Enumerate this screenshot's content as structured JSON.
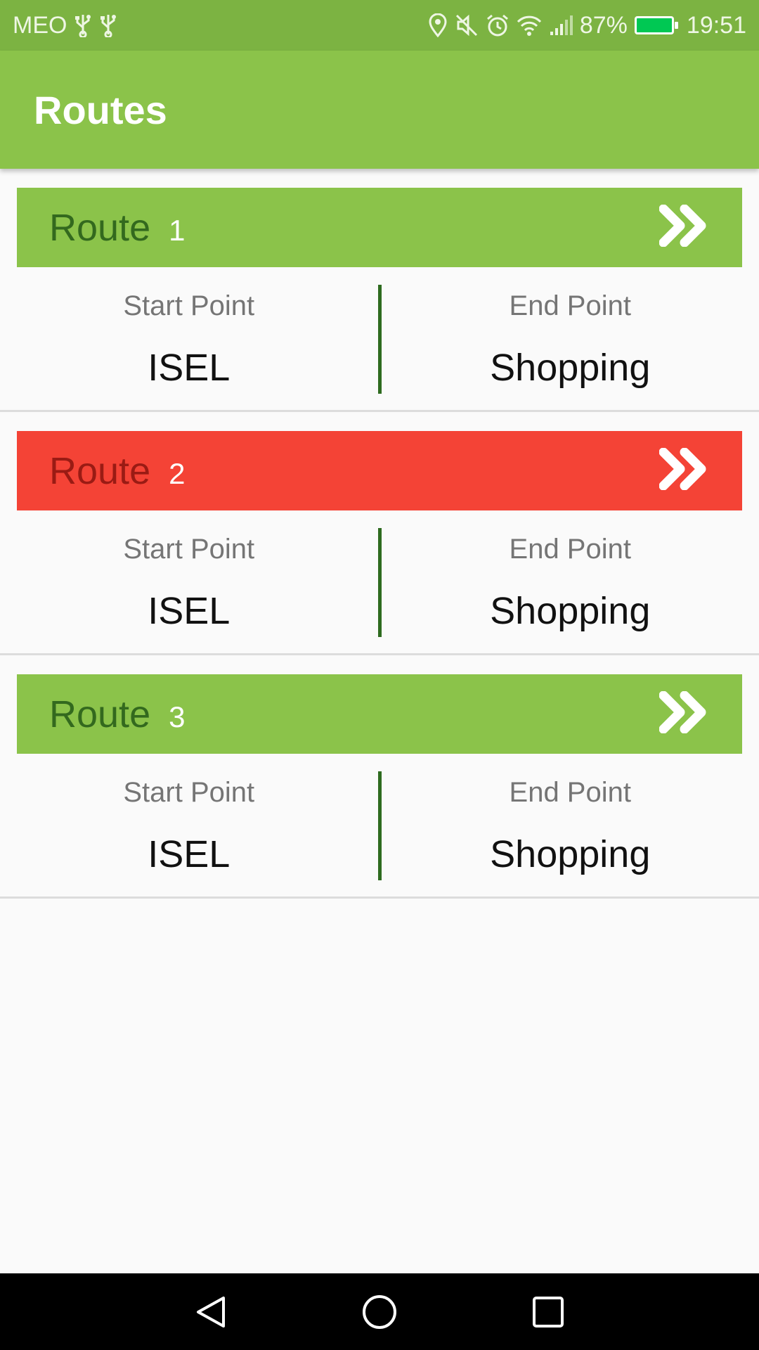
{
  "status_bar": {
    "carrier": "MEO",
    "battery_percent": "87%",
    "time": "19:51",
    "icons": [
      "usb-icon",
      "usb-icon",
      "location-icon",
      "mute-icon",
      "alarm-icon",
      "wifi-icon",
      "signal-icon",
      "battery-charging-icon"
    ]
  },
  "app_bar": {
    "title": "Routes"
  },
  "routes": [
    {
      "word": "Route",
      "number": "1",
      "status_color": "#8bc34a",
      "start_label": "Start Point",
      "start": "ISEL",
      "end_label": "End Point",
      "end": "Shopping",
      "action_icon": "double-chevron-right-icon"
    },
    {
      "word": "Route",
      "number": "2",
      "status_color": "#f44336",
      "start_label": "Start Point",
      "start": "ISEL",
      "end_label": "End Point",
      "end": "Shopping",
      "action_icon": "double-chevron-right-icon"
    },
    {
      "word": "Route",
      "number": "3",
      "status_color": "#8bc34a",
      "start_label": "Start Point",
      "start": "ISEL",
      "end_label": "End Point",
      "end": "Shopping",
      "action_icon": "double-chevron-right-icon"
    }
  ],
  "colors": {
    "status_bar": "#7cb342",
    "app_bar": "#8bc34a",
    "route_ok": "#8bc34a",
    "route_alert": "#f44336",
    "divider": "#2e6b1f"
  },
  "nav_bar": {
    "icons": [
      "back-icon",
      "home-icon",
      "recents-icon"
    ]
  }
}
